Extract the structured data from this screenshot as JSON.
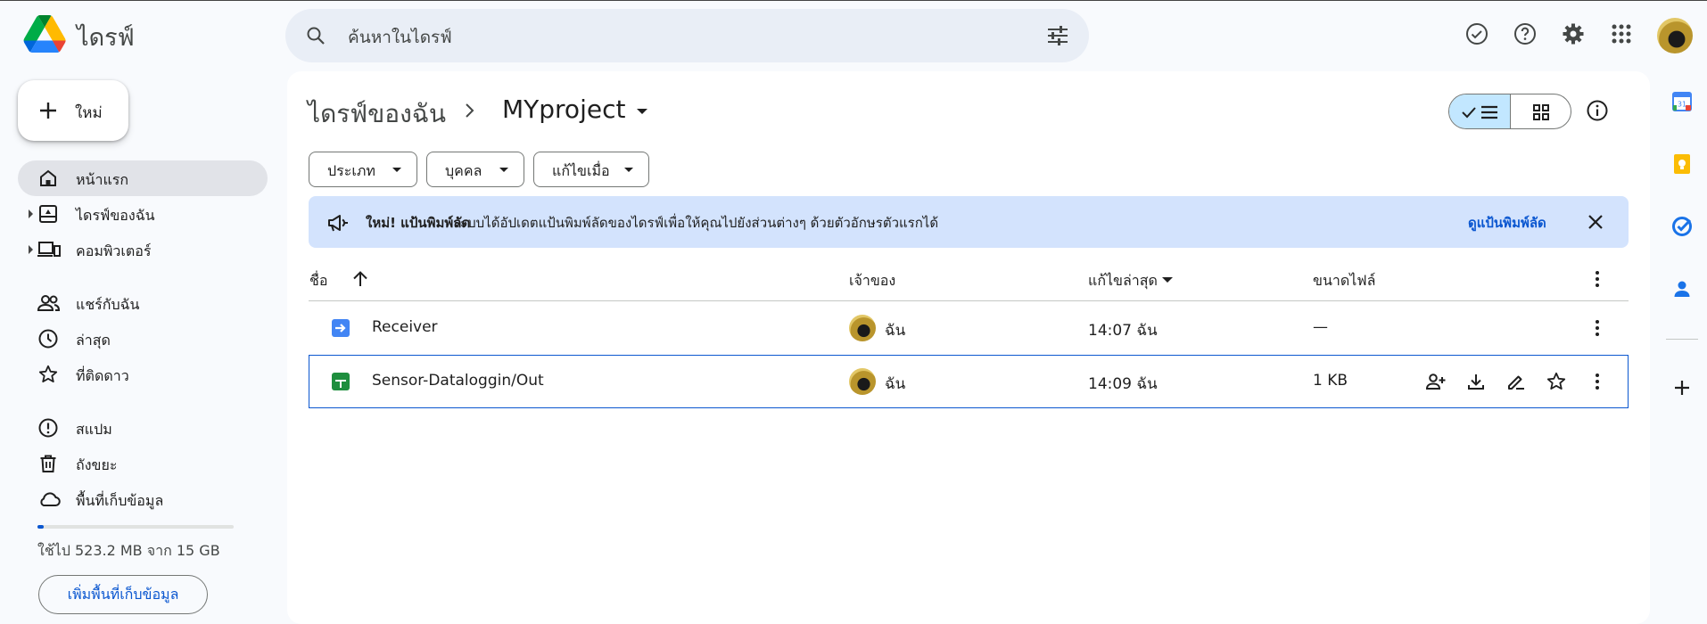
{
  "app": {
    "name": "ไดรฟ์"
  },
  "search": {
    "placeholder": "ค้นหาในไดรฟ์"
  },
  "sidebar": {
    "new_label": "ใหม่",
    "items": [
      {
        "label": "หน้าแรก"
      },
      {
        "label": "ไดรฟ์ของฉัน"
      },
      {
        "label": "คอมพิวเตอร์"
      },
      {
        "label": "แชร์กับฉัน"
      },
      {
        "label": "ล่าสุด"
      },
      {
        "label": "ที่ติดดาว"
      },
      {
        "label": "สแปม"
      },
      {
        "label": "ถังขยะ"
      },
      {
        "label": "พื้นที่เก็บข้อมูล"
      }
    ],
    "storage": {
      "used_text": "ใช้ไป 523.2 MB จาก 15 GB",
      "used_fraction": 0.034,
      "button_label": "เพิ่มพื้นที่เก็บข้อมูล"
    }
  },
  "breadcrumb": {
    "parent": "ไดรฟ์ของฉัน",
    "current": "MYproject"
  },
  "filters": [
    "ประเภท",
    "บุคคล",
    "แก้ไขเมื่อ"
  ],
  "banner": {
    "bold": "ใหม่! แป้นพิมพ์ลัด",
    "text": "ระบบได้อัปเดตแป้นพิมพ์ลัดของไดรฟ์เพื่อให้คุณไปยังส่วนต่างๆ ด้วยตัวอักษรตัวแรกได้",
    "link": "ดูแป้นพิมพ์ลัด"
  },
  "table": {
    "headers": {
      "name": "ชื่อ",
      "owner": "เจ้าของ",
      "modified": "แก้ไขล่าสุด",
      "size": "ขนาดไฟล์"
    },
    "rows": [
      {
        "name": "Receiver",
        "owner": "ฉัน",
        "modified": "14:07 ฉัน",
        "size": "—",
        "type": "shortcut"
      },
      {
        "name": "Sensor-Dataloggin/Out",
        "owner": "ฉัน",
        "modified": "14:09 ฉัน",
        "size": "1 KB",
        "type": "sheets"
      }
    ]
  },
  "colors": {
    "accent": "#0b57d0",
    "banner_bg": "#d3e3fd",
    "active_nav": "#e1e3e8",
    "view_selected": "#c2e7ff",
    "sheets_green": "#1e8e3e",
    "shortcut_blue": "#4285f4"
  }
}
